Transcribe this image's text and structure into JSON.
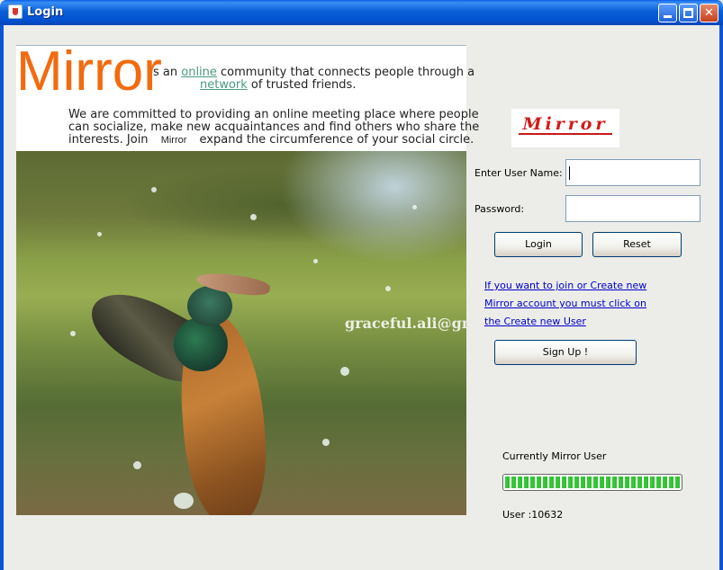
{
  "window": {
    "title": "Login",
    "minimize_glyph": "",
    "maximize_glyph": "",
    "close_glyph": "✕"
  },
  "banner": {
    "logo": "Mirror",
    "line1_prefix": "s an ",
    "line1_link": "online",
    "line1_suffix": " community that connects people through a",
    "line2_link": "network",
    "line2_suffix": " of trusted friends.",
    "para_line1": "We are committed to providing an online meeting place where people",
    "para_line2": "can socialize, make new acquaintances and find others who share the",
    "para_line3_prefix": "interests. Join ",
    "para_inline_logo": "Mirror",
    "para_line3_suffix": " expand the circumference of your social circle."
  },
  "photo": {
    "watermark": "graceful.ali@gm"
  },
  "form": {
    "logo": "Mirror",
    "username_label": "Enter User Name:",
    "username_value": "",
    "password_label": "Password:",
    "password_value": "",
    "login_button": "Login",
    "reset_button": "Reset",
    "signup_text_line1": "If you want to join or Create new",
    "signup_text_line2": "Mirror account you must click on",
    "signup_text_line3": "the Create new User",
    "signup_button": "Sign Up !"
  },
  "status": {
    "label": "Currently Mirror User",
    "progress": 1.0,
    "user_count_text": "User :10632"
  },
  "colors": {
    "title_bar": "#0a5fd8",
    "banner_logo": "#f26b0f",
    "form_logo": "#d11a1a",
    "link": "#0000cc",
    "progress": "#3ec93e"
  }
}
